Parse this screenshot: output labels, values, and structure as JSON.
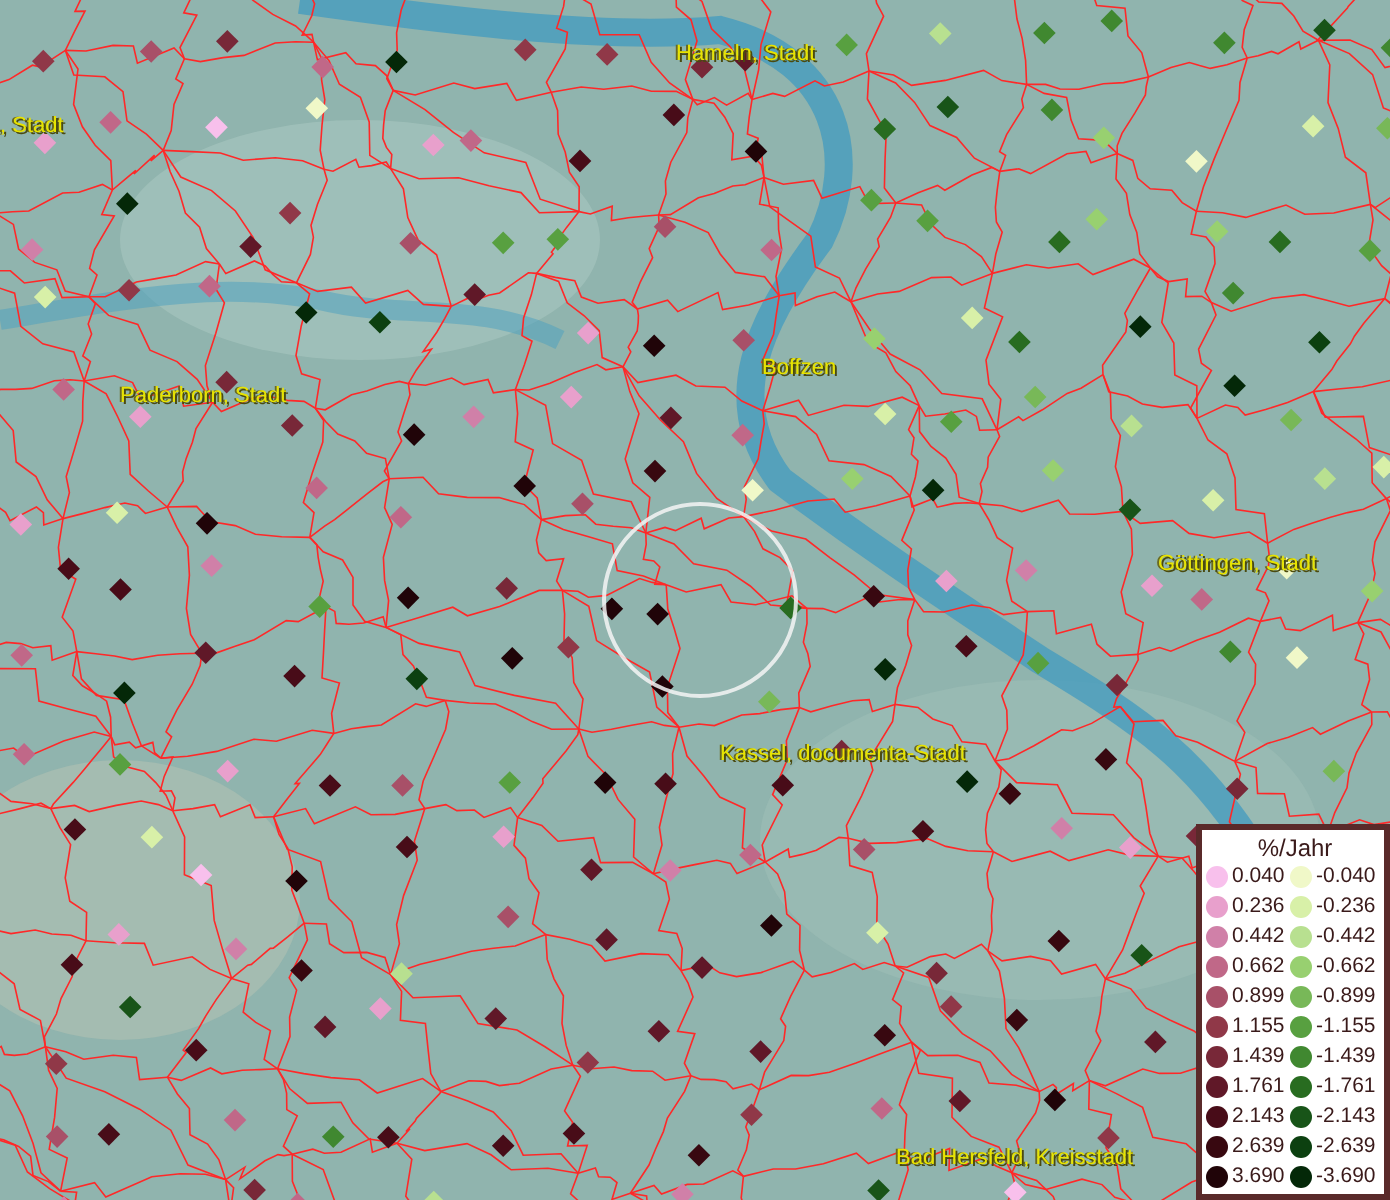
{
  "map_labels": [
    {
      "text": ", Stadt"
    },
    {
      "text": "Hameln, Stadt"
    },
    {
      "text": "Paderborn, Stadt"
    },
    {
      "text": "Boffzen"
    },
    {
      "text": "Göttingen, Stadt"
    },
    {
      "text": "Kassel, documenta-Stadt"
    },
    {
      "text": "Bad Hersfeld, Kreisstadt"
    }
  ],
  "legend": {
    "title": "%/Jahr",
    "entries": [
      {
        "label": "0.040",
        "color": "#f8c0ec"
      },
      {
        "label": "-0.040",
        "color": "#f0f8c8"
      },
      {
        "label": "0.236",
        "color": "#e8a0cc"
      },
      {
        "label": "-0.236",
        "color": "#d8f0a8"
      },
      {
        "label": "0.442",
        "color": "#d080a8"
      },
      {
        "label": "-0.442",
        "color": "#b8e090"
      },
      {
        "label": "0.662",
        "color": "#c06888"
      },
      {
        "label": "-0.662",
        "color": "#98d070"
      },
      {
        "label": "0.899",
        "color": "#a85068"
      },
      {
        "label": "-0.899",
        "color": "#78b858"
      },
      {
        "label": "1.155",
        "color": "#903848"
      },
      {
        "label": "-1.155",
        "color": "#58a040"
      },
      {
        "label": "1.439",
        "color": "#782838"
      },
      {
        "label": "-1.439",
        "color": "#408830"
      },
      {
        "label": "1.761",
        "color": "#601828"
      },
      {
        "label": "-1.761",
        "color": "#286c20"
      },
      {
        "label": "2.143",
        "color": "#480c18"
      },
      {
        "label": "-2.143",
        "color": "#185418"
      },
      {
        "label": "2.639",
        "color": "#380810"
      },
      {
        "label": "-2.639",
        "color": "#0c4010"
      },
      {
        "label": "3.690",
        "color": "#200408"
      },
      {
        "label": "-3.690",
        "color": "#042808"
      }
    ]
  }
}
